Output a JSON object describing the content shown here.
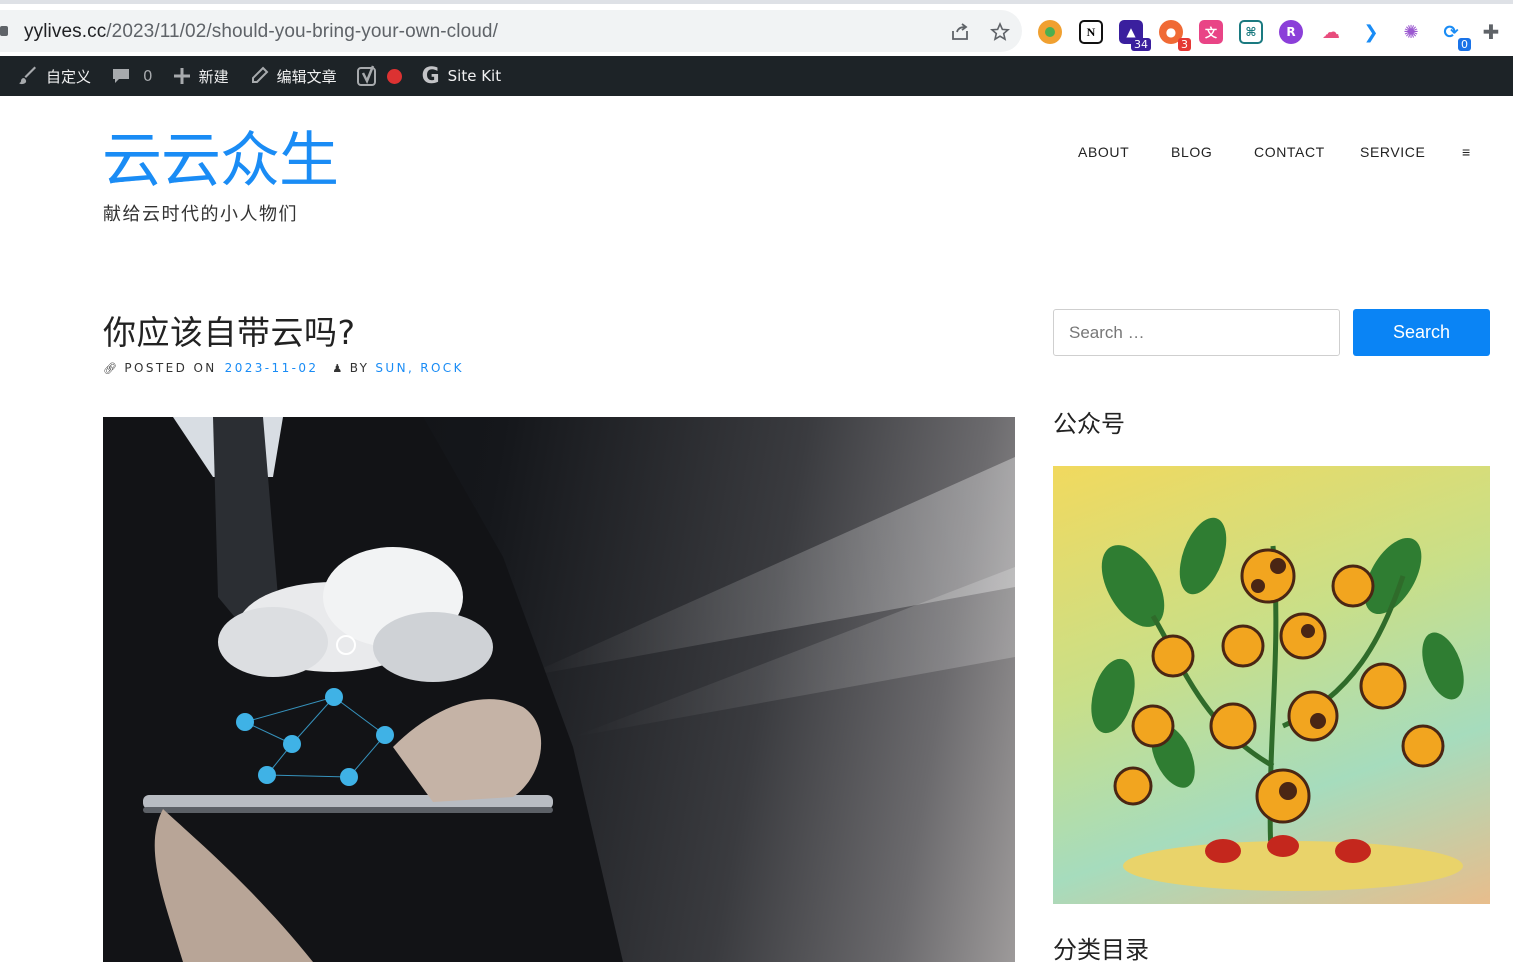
{
  "browser": {
    "url_host": "yylives.cc",
    "url_path": "/2023/11/02/should-you-bring-your-own-cloud/",
    "extensions": [
      {
        "name": "ext-circle-icon",
        "badge": ""
      },
      {
        "name": "notion-icon",
        "badge": ""
      },
      {
        "name": "hat-icon",
        "badge": "34"
      },
      {
        "name": "bubbles-icon",
        "badge": "3"
      },
      {
        "name": "translate-icon",
        "badge": ""
      },
      {
        "name": "grid-icon",
        "badge": ""
      },
      {
        "name": "purple-ext-icon",
        "badge": ""
      },
      {
        "name": "cloud-ext-icon",
        "badge": ""
      },
      {
        "name": "pin-ext-icon",
        "badge": ""
      },
      {
        "name": "openai-icon",
        "badge": ""
      },
      {
        "name": "sync-icon",
        "badge": "0"
      },
      {
        "name": "puzzle-icon",
        "badge": ""
      }
    ]
  },
  "adminbar": {
    "customize": "自定义",
    "comments_count": "0",
    "new": "新建",
    "edit": "编辑文章",
    "site_kit": "Site Kit"
  },
  "site": {
    "title": "云云众生",
    "description": "献给云时代的小人物们"
  },
  "nav": {
    "about": "ABOUT",
    "blog": "BLOG",
    "contact": "CONTACT",
    "service": "SERVICE",
    "menu": "≡"
  },
  "post": {
    "title": "你应该自带云吗?",
    "posted_on_label": "POSTED ON",
    "date": "2023-11-02",
    "by_label": "BY",
    "author1": "SUN",
    "separator": ",",
    "author2": "ROCK"
  },
  "sidebar": {
    "search_placeholder": "Search …",
    "search_button": "Search",
    "widget1_title": "公众号",
    "widget2_title": "分类目录"
  },
  "colors": {
    "accent": "#1a8cf5",
    "search_button": "#0a84f5",
    "adminbar_bg": "#1d2327"
  }
}
